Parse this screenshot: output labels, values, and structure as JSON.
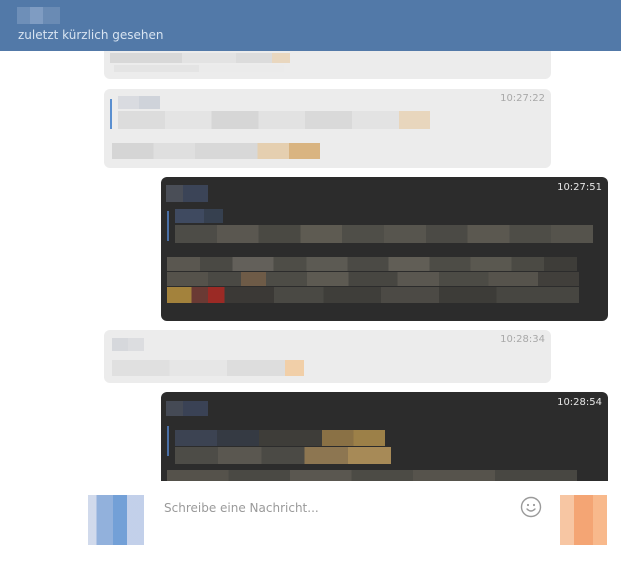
{
  "header": {
    "contact_name": "",
    "status": "zuletzt kürzlich gesehen",
    "color": "#5279a8"
  },
  "messages": [
    {
      "direction": "incoming",
      "time": "",
      "has_quote": false
    },
    {
      "direction": "incoming",
      "time": "10:27:22",
      "has_quote": true
    },
    {
      "direction": "outgoing",
      "time": "10:27:51",
      "has_quote": true
    },
    {
      "direction": "incoming",
      "time": "10:28:34",
      "has_quote": false
    },
    {
      "direction": "outgoing",
      "time": "10:28:54",
      "has_quote": true
    }
  ],
  "composer": {
    "placeholder": "Schreibe eine Nachricht...",
    "emoji_icon": "smiley-icon"
  },
  "colors": {
    "incoming_bubble": "#ececec",
    "outgoing_bubble": "#2c2c2c",
    "accent": "#5a8fd0"
  }
}
